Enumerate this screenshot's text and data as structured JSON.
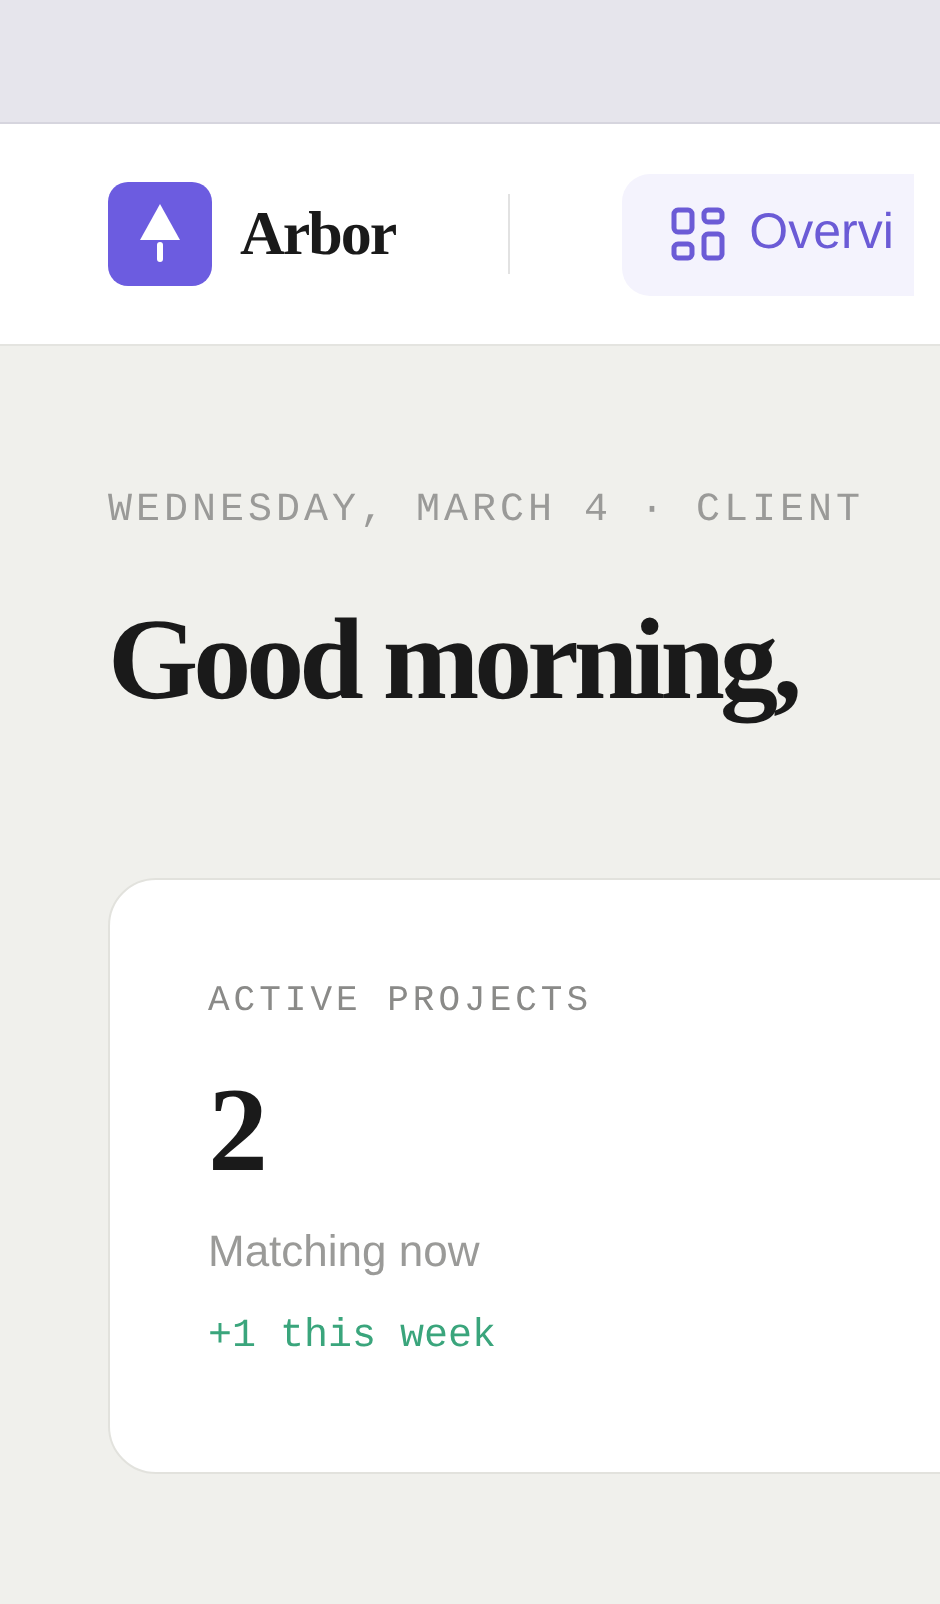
{
  "header": {
    "brand": "Arbor",
    "nav": [
      {
        "label": "Overvi",
        "selected": true
      }
    ]
  },
  "greeting": {
    "eyebrow": "WEDNESDAY, MARCH 4 · CLIENT",
    "title": "Good morning,"
  },
  "stats": [
    {
      "label": "ACTIVE PROJECTS",
      "value": "2",
      "caption": "Matching now",
      "delta": "+1 this week"
    }
  ]
}
